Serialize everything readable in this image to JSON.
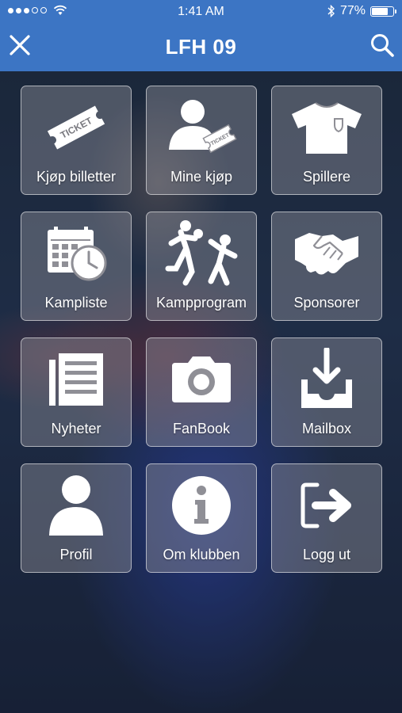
{
  "status_bar": {
    "time": "1:41 AM",
    "battery": "77%",
    "battery_level": 0.77,
    "signal_bars_filled": 3,
    "signal_bars_total": 5
  },
  "header": {
    "title": "LFH 09"
  },
  "menu": [
    {
      "label": "Kjøp billetter",
      "icon": "ticket-icon",
      "ticket_text": "TICKET"
    },
    {
      "label": "Mine kjøp",
      "icon": "user-ticket-icon",
      "ticket_text": "TICKET"
    },
    {
      "label": "Spillere",
      "icon": "jersey-icon"
    },
    {
      "label": "Kampliste",
      "icon": "calendar-clock-icon"
    },
    {
      "label": "Kampprogram",
      "icon": "handball-players-icon"
    },
    {
      "label": "Sponsorer",
      "icon": "handshake-icon"
    },
    {
      "label": "Nyheter",
      "icon": "newspaper-icon"
    },
    {
      "label": "FanBook",
      "icon": "camera-icon"
    },
    {
      "label": "Mailbox",
      "icon": "inbox-download-icon"
    },
    {
      "label": "Profil",
      "icon": "person-icon"
    },
    {
      "label": "Om klubben",
      "icon": "info-icon"
    },
    {
      "label": "Logg ut",
      "icon": "logout-icon"
    }
  ]
}
